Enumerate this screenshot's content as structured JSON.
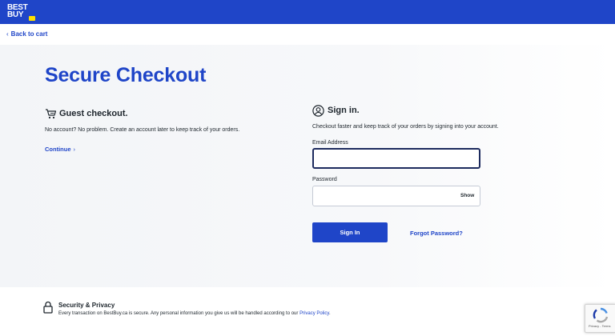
{
  "header": {
    "logo_line1": "BEST",
    "logo_line2": "BUY",
    "brand_color": "#1f45c8",
    "tag_color": "#ffe000"
  },
  "nav": {
    "back_label": "Back to cart",
    "back_icon": "chevron-left-icon"
  },
  "page": {
    "title": "Secure Checkout"
  },
  "guest": {
    "icon": "cart-icon",
    "heading": "Guest checkout.",
    "description": "No account? No problem. Create an account later to keep track of your orders.",
    "continue_label": "Continue",
    "continue_icon": "chevron-right-icon"
  },
  "signin": {
    "icon": "user-circle-icon",
    "heading": "Sign in.",
    "description": "Checkout faster and keep track of your orders by signing into your account.",
    "email_label": "Email Address",
    "email_value": "",
    "password_label": "Password",
    "password_value": "",
    "show_label": "Show",
    "button_label": "Sign In",
    "forgot_label": "Forgot Password?"
  },
  "footer": {
    "icon": "lock-icon",
    "heading": "Security & Privacy",
    "text": "Every transaction on BestBuy.ca is secure. Any personal information you give us will be handled according to our",
    "link_label": "Privacy Policy",
    "text_end": "."
  },
  "recaptcha": {
    "icon": "recaptcha-icon",
    "links": "Privacy - Terms"
  }
}
